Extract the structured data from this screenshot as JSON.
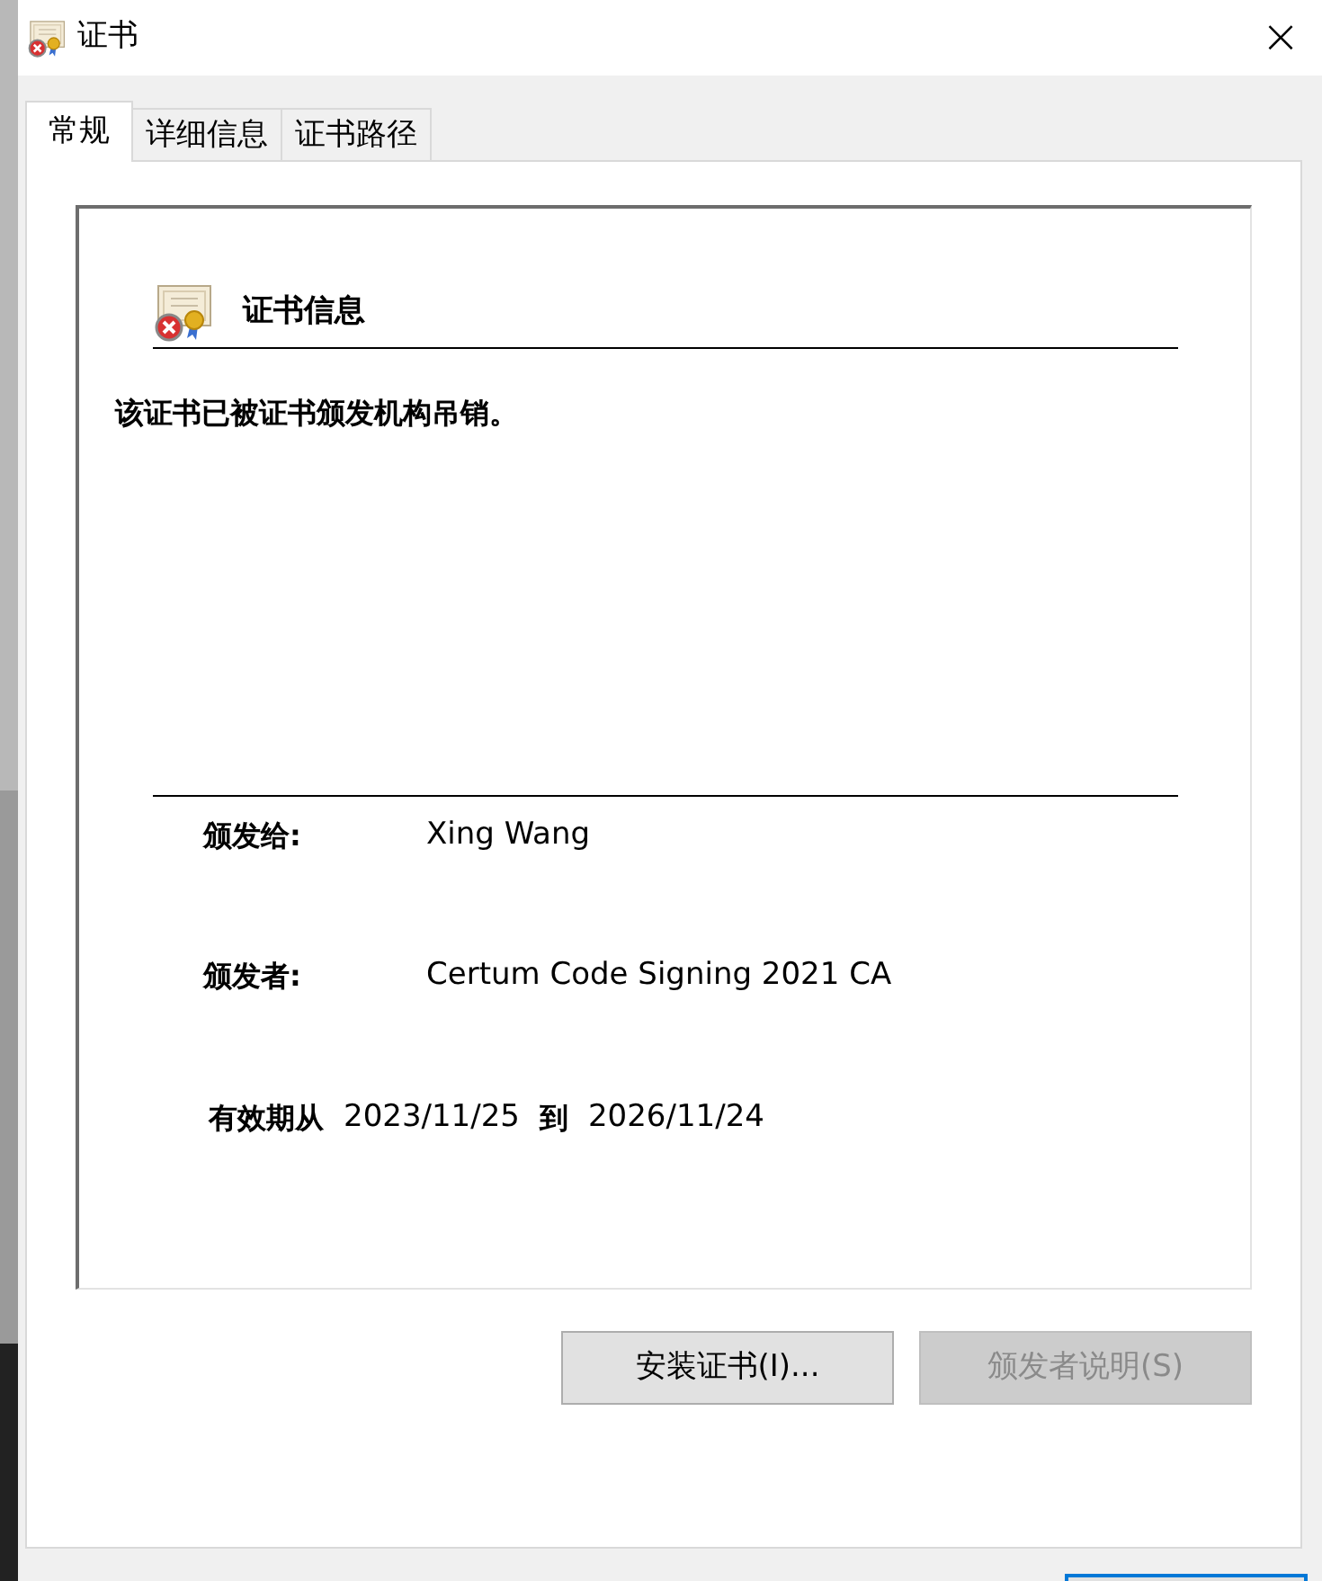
{
  "window": {
    "title": "证书",
    "close": "×"
  },
  "tabs": [
    {
      "label": "常规",
      "selected": true
    },
    {
      "label": "详细信息",
      "selected": false
    },
    {
      "label": "证书路径",
      "selected": false
    }
  ],
  "info": {
    "heading": "证书信息",
    "status": "该证书已被证书颁发机构吊销。"
  },
  "fields": [
    {
      "label": "颁发给:",
      "value": "Xing Wang"
    },
    {
      "label": "颁发者:",
      "value": "Certum Code Signing 2021 CA"
    }
  ],
  "validity": {
    "label": "有效期从",
    "from": "2023/11/25",
    "to_label": "到",
    "to": "2026/11/24"
  },
  "buttons": [
    {
      "label": "安装证书(I)...",
      "disabled": false
    },
    {
      "label": "颁发者说明(S)",
      "disabled": true
    }
  ]
}
